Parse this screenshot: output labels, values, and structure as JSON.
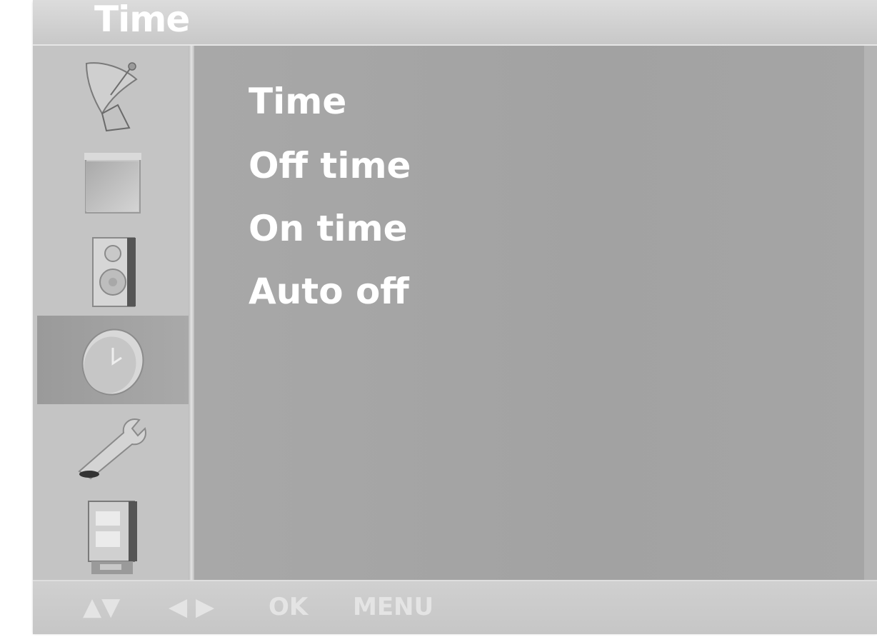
{
  "header": {
    "title": "Time"
  },
  "sidebar": {
    "items": [
      {
        "name": "satellite-dish-icon"
      },
      {
        "name": "picture-icon"
      },
      {
        "name": "speaker-icon"
      },
      {
        "name": "clock-icon",
        "selected": true
      },
      {
        "name": "wrench-icon"
      },
      {
        "name": "tv-icon"
      }
    ]
  },
  "menu": {
    "items": [
      {
        "label": "Time"
      },
      {
        "label": "Off time"
      },
      {
        "label": "On time"
      },
      {
        "label": "Auto off"
      }
    ]
  },
  "footer": {
    "up_down": "▲▼",
    "left_right": "◀ ▶",
    "ok": "OK",
    "menu": "MENU"
  },
  "colors": {
    "panel": "#c9c9c9",
    "content": "#a5a5a5",
    "selected": "#a0a0a0",
    "text": "#ffffff"
  }
}
